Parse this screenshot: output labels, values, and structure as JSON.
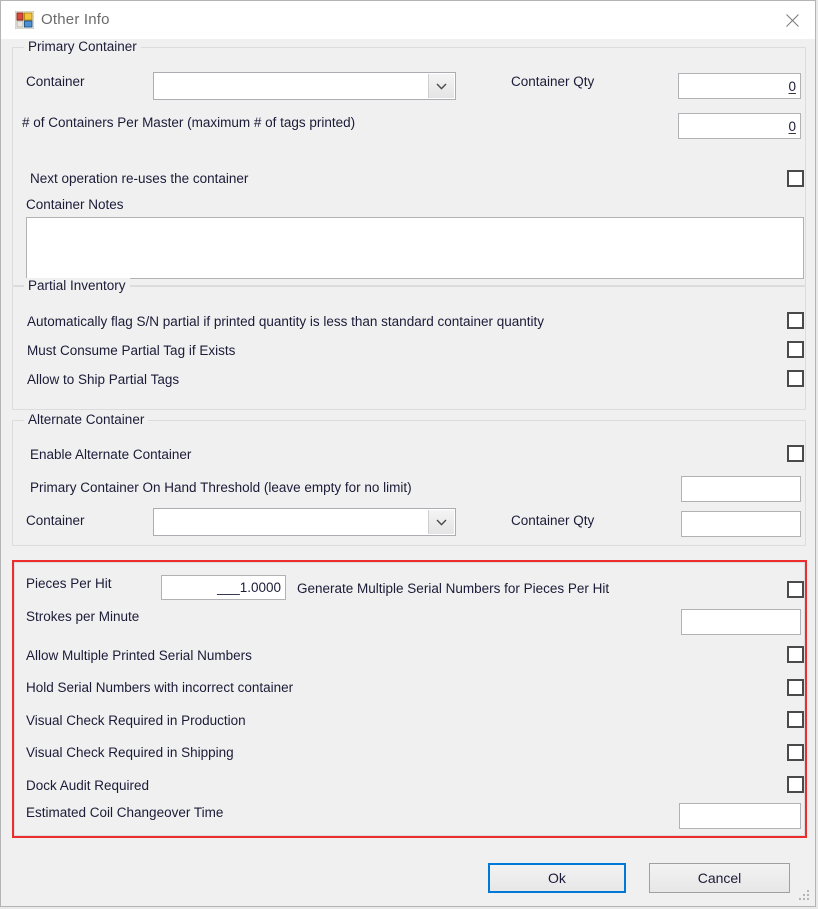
{
  "window": {
    "title": "Other Info",
    "icon": "app-window-icon",
    "close_label": "✕"
  },
  "accent": {
    "highlight_red": "#ec2d2d",
    "focus_blue": "#0078d7"
  },
  "primary_container": {
    "group_title": "Primary Container",
    "container_label": "Container",
    "container_value": "",
    "container_qty_label": "Container Qty",
    "container_qty_value": "0",
    "containers_per_master_label": "# of Containers Per Master (maximum # of tags printed)",
    "containers_per_master_value": "0",
    "reuse_label": "Next operation re-uses the container",
    "reuse_checked": false,
    "notes_label": "Container Notes",
    "notes_value": ""
  },
  "partial_inventory": {
    "group_title": "Partial Inventory",
    "rows": [
      {
        "label": "Automatically flag S/N partial if printed quantity is less than standard container quantity",
        "checked": false
      },
      {
        "label": "Must Consume Partial Tag if Exists",
        "checked": false
      },
      {
        "label": "Allow to Ship Partial Tags",
        "checked": false
      }
    ]
  },
  "alternate_container": {
    "group_title": "Alternate Container",
    "enable_label": "Enable Alternate Container",
    "enable_checked": false,
    "threshold_label": "Primary Container On Hand Threshold (leave empty for no limit)",
    "threshold_value": "",
    "container_label": "Container",
    "container_value": "",
    "container_qty_label": "Container Qty",
    "container_qty_value": ""
  },
  "highlighted_section": {
    "pieces_per_hit_label": "Pieces Per Hit",
    "pieces_per_hit_value": "___1.0000",
    "generate_multiple_label": "Generate Multiple Serial Numbers for Pieces Per Hit",
    "generate_multiple_checked": false,
    "strokes_label": "Strokes per Minute",
    "strokes_value": "",
    "rows": [
      {
        "label": "Allow Multiple Printed Serial Numbers",
        "checked": false
      },
      {
        "label": "Hold Serial Numbers with incorrect container",
        "checked": false
      },
      {
        "label": "Visual Check Required in Production",
        "checked": false
      },
      {
        "label": "Visual Check Required in Shipping",
        "checked": false
      },
      {
        "label": "Dock Audit Required",
        "checked": false
      }
    ],
    "coil_label": "Estimated Coil Changeover Time",
    "coil_value": ""
  },
  "footer": {
    "ok_label": "Ok",
    "cancel_label": "Cancel"
  }
}
